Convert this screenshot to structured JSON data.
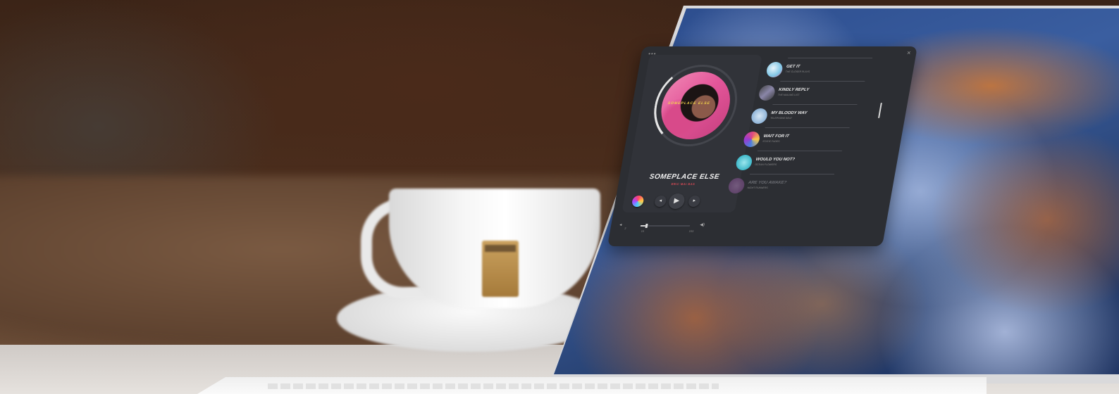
{
  "scene": {
    "description_colors": {
      "wall": "#3b2417",
      "table": "#e6e2de",
      "laptop": "#d9d9db",
      "app_bg": "#2c2e33",
      "accent": "#e04b57"
    }
  },
  "app": {
    "now_playing": {
      "album_text": "SOMEPLACE ELSE",
      "title": "SOMEPLACE ELSE",
      "artist": "ERIC MAI BAS",
      "progress": 0.1
    },
    "controls": {
      "color_icon": "color-wheel-icon",
      "prev": "◂",
      "play": "▶",
      "next": "▸"
    },
    "playlist": [
      {
        "title": "GET IT",
        "subtitle": "THE CLOSER PLAYS",
        "color": "#7fc6e6"
      },
      {
        "title": "KINDLY REPLY",
        "subtitle": "THE MAILING LIST",
        "color": "#6c6a8a"
      },
      {
        "title": "MY BLOODY WAY",
        "subtitle": "TELEPHONE BEAT",
        "color": "#8fb4d8"
      },
      {
        "title": "WAIT FOR IT",
        "subtitle": "STATIC FADES",
        "color": "#e04a7e"
      },
      {
        "title": "WOULD YOU NOT?",
        "subtitle": "OCEAN FLOWERS",
        "color": "#3fb8c9"
      },
      {
        "title": "ARE YOU AWAKE?",
        "subtitle": "NIGHT RUNNERS",
        "color": "#9a5aa8"
      }
    ],
    "bottom": {
      "left_icon": "◂",
      "left_num": "2",
      "mid_num": "10",
      "right_num": "103",
      "vol_icon": "◀)"
    }
  }
}
